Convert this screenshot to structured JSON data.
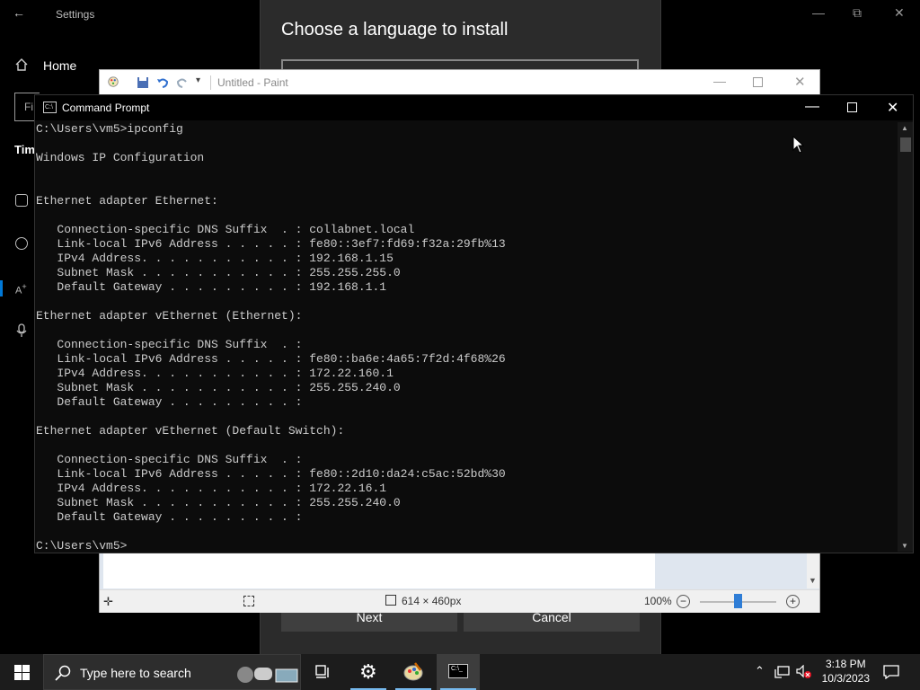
{
  "settings": {
    "title": "Settings",
    "home_label": "Home",
    "find_placeholder": "Fi",
    "section_partial": "Tim"
  },
  "language_dialog": {
    "heading": "Choose a language to install",
    "next_label": "Next",
    "cancel_label": "Cancel"
  },
  "paint": {
    "title": "Untitled - Paint",
    "canvas_size": "614 × 460px",
    "zoom": "100%"
  },
  "cmd": {
    "title": "Command Prompt",
    "output": "C:\\Users\\vm5>ipconfig\n\nWindows IP Configuration\n\n\nEthernet adapter Ethernet:\n\n   Connection-specific DNS Suffix  . : collabnet.local\n   Link-local IPv6 Address . . . . . : fe80::3ef7:fd69:f32a:29fb%13\n   IPv4 Address. . . . . . . . . . . : 192.168.1.15\n   Subnet Mask . . . . . . . . . . . : 255.255.255.0\n   Default Gateway . . . . . . . . . : 192.168.1.1\n\nEthernet adapter vEthernet (Ethernet):\n\n   Connection-specific DNS Suffix  . :\n   Link-local IPv6 Address . . . . . : fe80::ba6e:4a65:7f2d:4f68%26\n   IPv4 Address. . . . . . . . . . . : 172.22.160.1\n   Subnet Mask . . . . . . . . . . . : 255.255.240.0\n   Default Gateway . . . . . . . . . :\n\nEthernet adapter vEthernet (Default Switch):\n\n   Connection-specific DNS Suffix  . :\n   Link-local IPv6 Address . . . . . : fe80::2d10:da24:c5ac:52bd%30\n   IPv4 Address. . . . . . . . . . . : 172.22.16.1\n   Subnet Mask . . . . . . . . . . . : 255.255.240.0\n   Default Gateway . . . . . . . . . :\n\nC:\\Users\\vm5>"
  },
  "taskbar": {
    "search_placeholder": "Type here to search",
    "time": "3:18 PM",
    "date": "10/3/2023",
    "apps": [
      "task-view",
      "settings",
      "paint",
      "command-prompt"
    ]
  },
  "colors": {
    "accent": "#0078d7",
    "console_text": "#cccccc",
    "console_bg": "#0c0c0c",
    "taskbar_active": "#76b9ed"
  }
}
